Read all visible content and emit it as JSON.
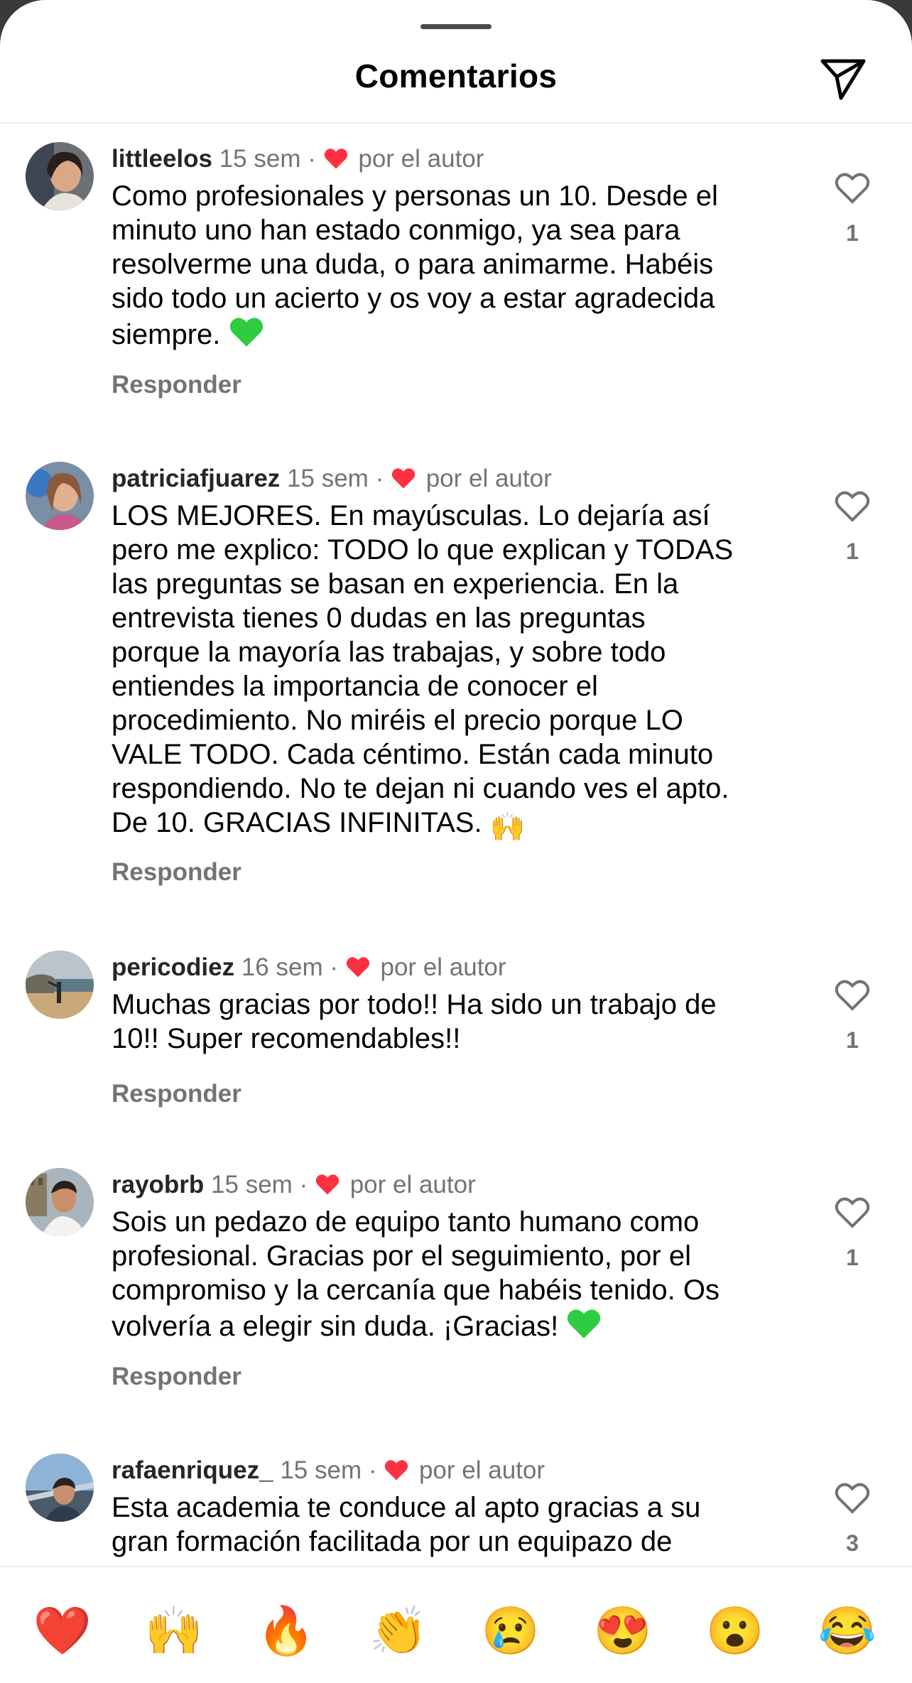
{
  "header": {
    "title": "Comentarios",
    "send_icon": "paper-plane-icon"
  },
  "comments": [
    {
      "username": "littleelos",
      "time": "15 sem",
      "author_like": "por el autor",
      "text": "Como profesionales y personas un 10. Desde el\nminuto uno han estado conmigo, ya sea para\nresolverme una duda, o para animarme. Habéis\nsido todo un acierto y os voy a estar agradecida\nsiempre.",
      "emoji": "green-heart",
      "likes": "1",
      "reply": "Responder"
    },
    {
      "username": "patriciafjuarez",
      "time": "15 sem",
      "author_like": "por el autor",
      "text": "LOS MEJORES. En mayúsculas. Lo dejaría así\npero me explico: TODO lo que explican y TODAS\nlas preguntas se basan en experiencia. En la\nentrevista tienes 0 dudas en las preguntas\nporque la mayoría las trabajas, y sobre todo\nentiendes la importancia de conocer el\nprocedimiento. No miréis el precio porque LO\nVALE TODO. Cada céntimo. Están cada minuto\nrespondiendo. No te dejan ni cuando ves el apto.\nDe 10. GRACIAS INFINITAS.",
      "emoji": "raising-hands",
      "likes": "1",
      "reply": "Responder"
    },
    {
      "username": "pericodiez",
      "time": "16 sem",
      "author_like": "por el autor",
      "text": "Muchas gracias por todo!! Ha sido un trabajo de\n10!! Super recomendables!!",
      "emoji": "",
      "likes": "1",
      "reply": "Responder"
    },
    {
      "username": "rayobrb",
      "time": "15 sem",
      "author_like": "por el autor",
      "text": "Sois un pedazo de equipo tanto humano como\nprofesional. Gracias por el seguimiento, por el\ncompromiso y la cercanía que habéis tenido. Os\nvolvería a elegir sin duda. ¡Gracias!",
      "emoji": "green-heart",
      "likes": "1",
      "reply": "Responder"
    },
    {
      "username": "rafaenriquez_",
      "time": "15 sem",
      "author_like": "por el autor",
      "text": "Esta academia te conduce al apto gracias a su\ngran formación facilitada por un equipazo de",
      "emoji": "",
      "likes": "3",
      "reply": ""
    }
  ],
  "reactions": [
    "❤️",
    "🙌",
    "🔥",
    "👏",
    "😢",
    "😍",
    "😮",
    "😂"
  ],
  "colors": {
    "like_red": "#ff3040",
    "secondary_text": "#737373",
    "green_heart": "#2ecc40"
  }
}
